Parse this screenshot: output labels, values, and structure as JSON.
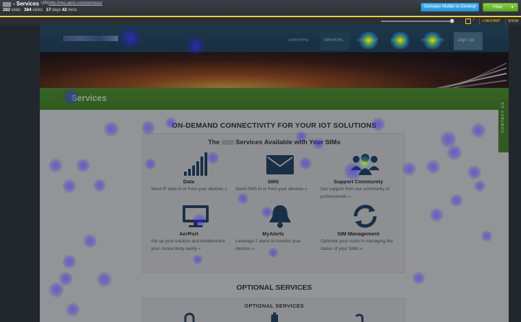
{
  "analytics": {
    "page_title": "- Services",
    "url_label": "URL",
    "url": "http://neo.aeris.com/services/",
    "stats": {
      "visits_value": "282",
      "visits_label": "visits",
      "clicks_value": "384",
      "clicks_label": "clicks",
      "days_value": "17",
      "days_label": "days",
      "mins_value": "42",
      "mins_label": "mins"
    },
    "compare_button": "Compare Mobile vs Desktop",
    "filter_button": "Filter",
    "restart_label": "+ RESTART",
    "show_label": "SHOW"
  },
  "site": {
    "nav": [
      "overview",
      "services",
      "coverage",
      "pricing",
      "resources",
      "sign up"
    ],
    "banner_title": "Services",
    "contact_tab": "CONTACT US",
    "main_heading": "ON-DEMAND CONNECTIVITY FOR YOUR IOT SOLUTIONS",
    "panel_title_before": "The",
    "panel_title_after": "Services Available with Your SIMs",
    "services": [
      {
        "name": "Data",
        "desc": "Send IP data to or from your devices »",
        "icon": "signal-bars-icon"
      },
      {
        "name": "SMS",
        "desc": "Send SMS to or from your devices »",
        "icon": "envelope-icon"
      },
      {
        "name": "Support Community",
        "desc": "Get support from our community of professionals »",
        "icon": "people-icon"
      },
      {
        "name": "AerPort",
        "desc": "Set up your solution and troubleshoot your connectivity easily »",
        "icon": "monitor-icon"
      },
      {
        "name": "MyAlerts",
        "desc": "Leverage 2 alerts to monitor your devices »",
        "icon": "bell-icon"
      },
      {
        "name": "SIM Management",
        "desc": "Optimize your costs in managing the status of your SIMs »",
        "icon": "refresh-icon"
      }
    ],
    "optional_heading": "OPTIONAL SERVICES",
    "optional_panel_title": "OPTIONAL SERVICES"
  },
  "colors": {
    "accent_blue": "#2a93d6",
    "filter_green": "#5da826",
    "toolbar_yellow": "#f3d23a",
    "banner_green": "#3e7f22",
    "header_navy": "#1c3b55"
  }
}
